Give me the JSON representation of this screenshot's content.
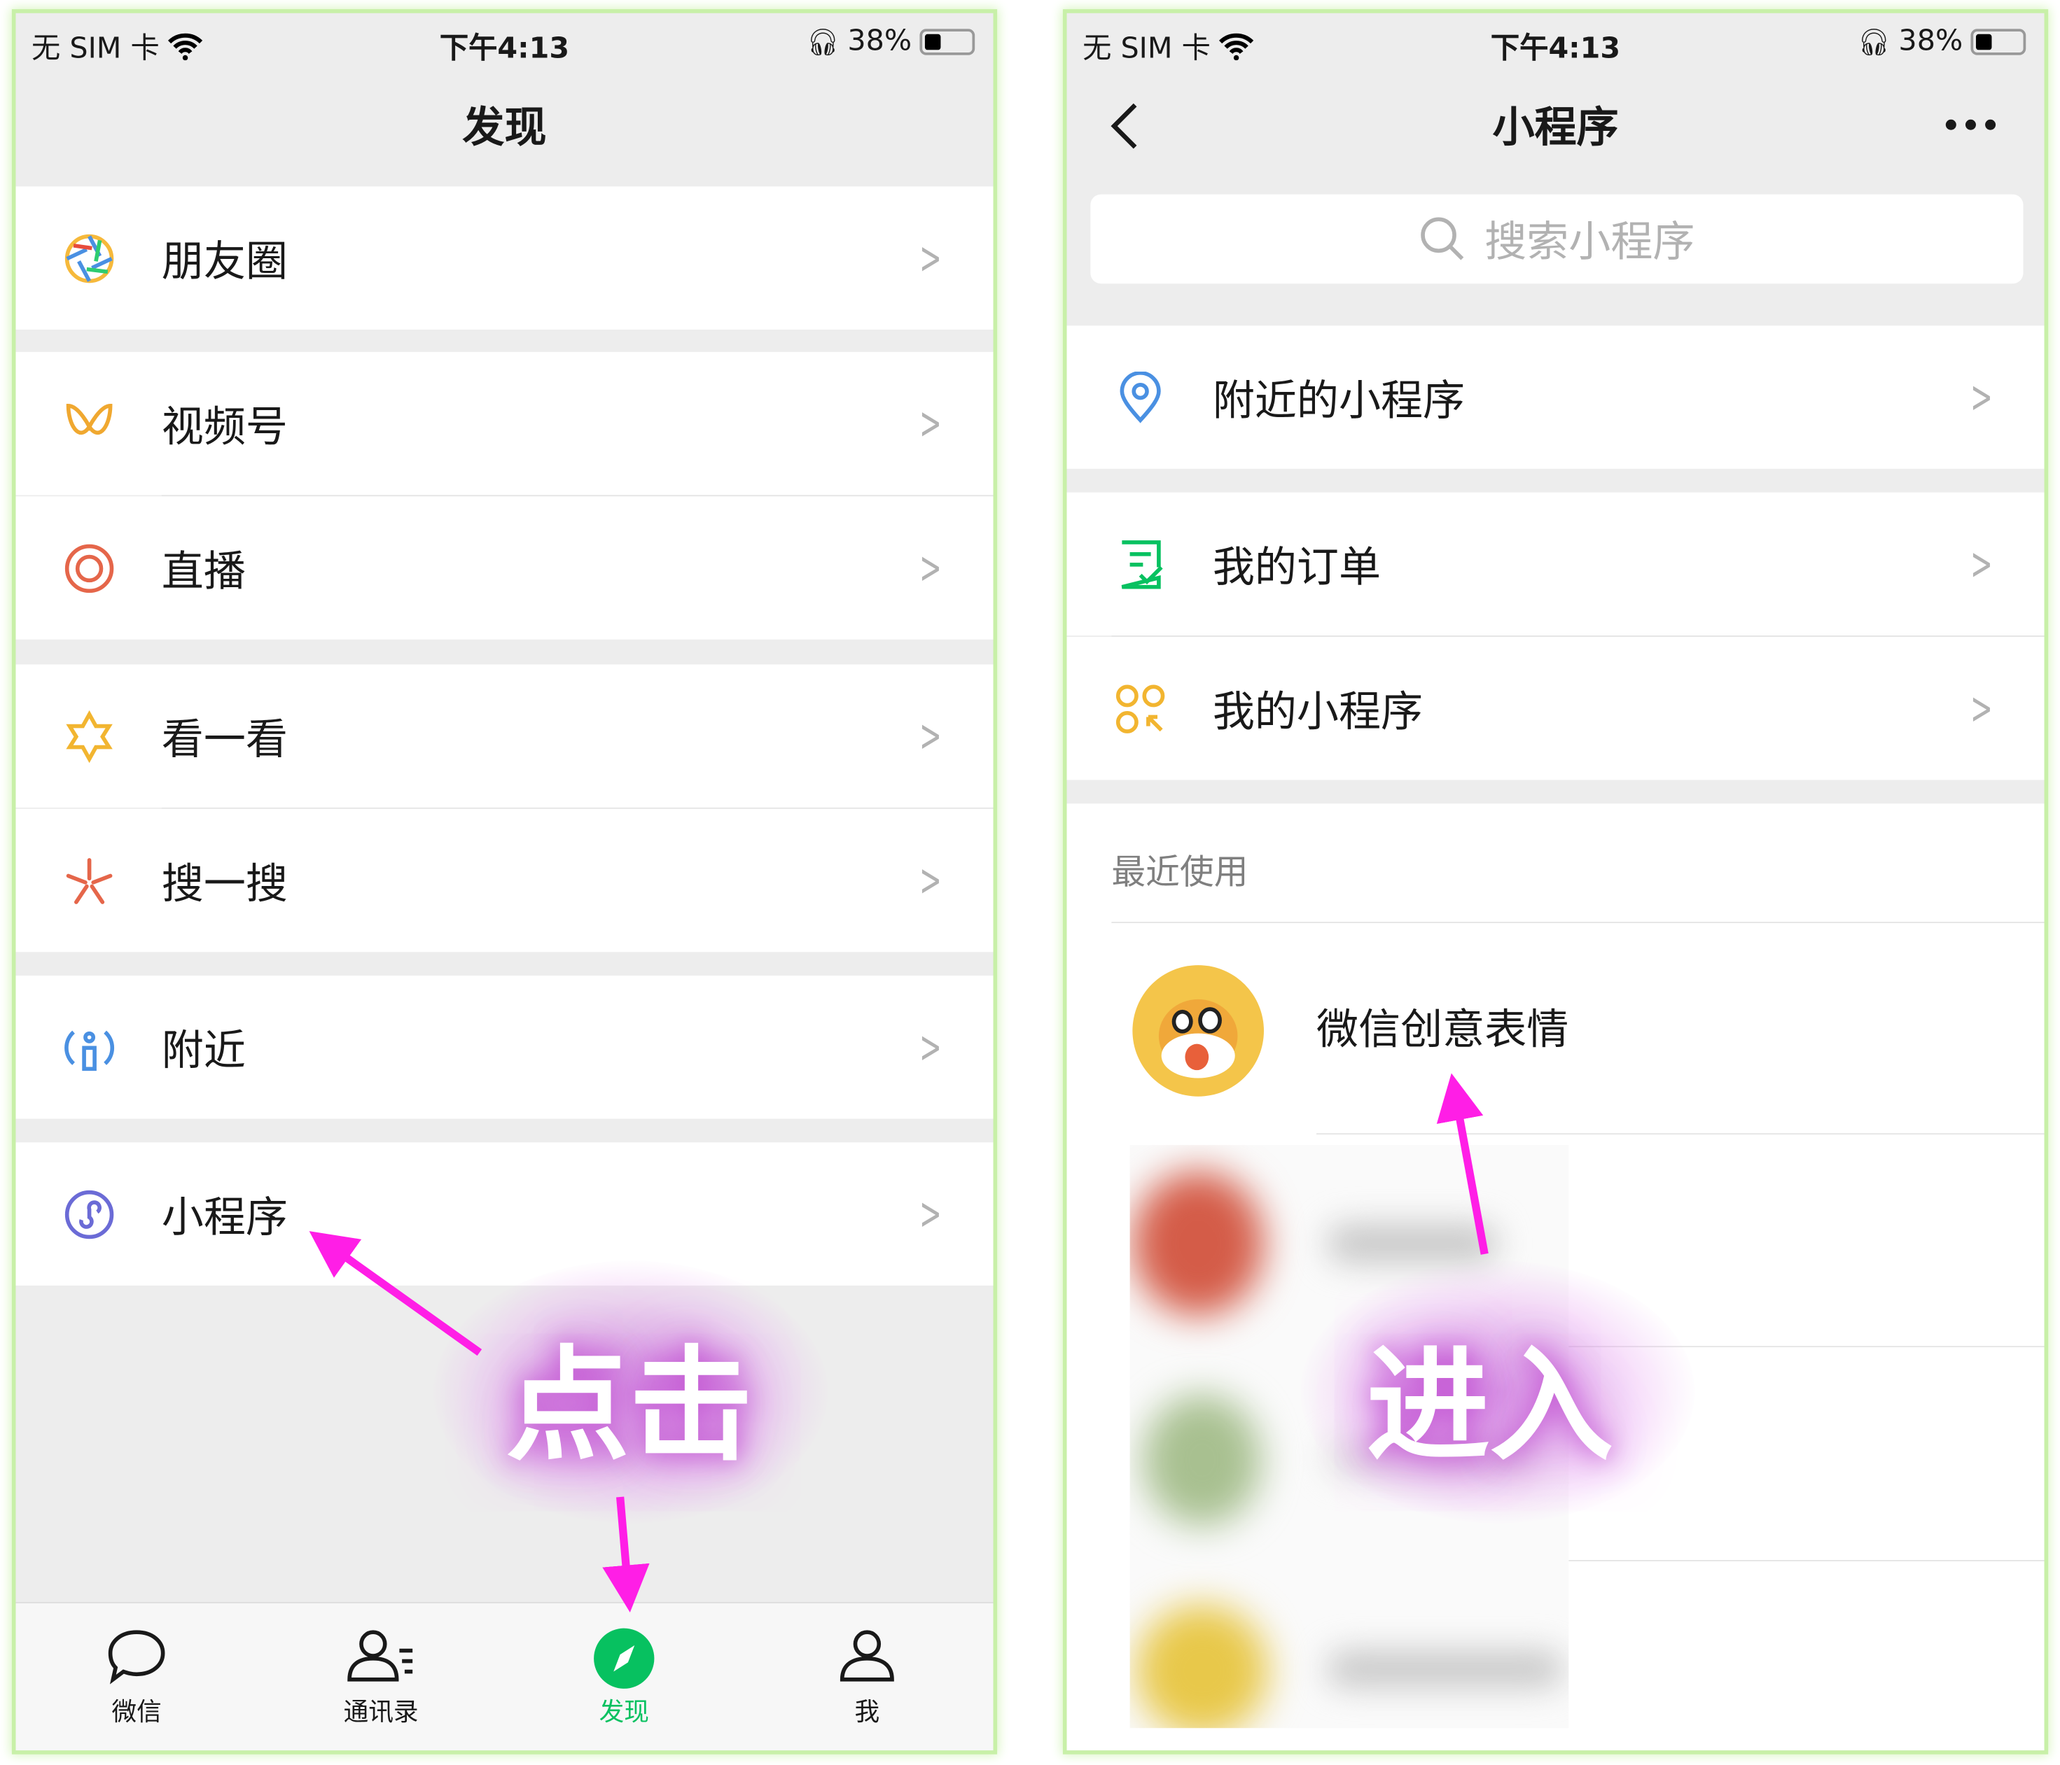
{
  "status_bar": {
    "carrier": "无 SIM 卡",
    "time": "下午4:13",
    "battery": "38%",
    "battery_level": 0.38
  },
  "left": {
    "title": "发现",
    "items": [
      {
        "label": "朋友圈",
        "icon": "moments-aperture-icon"
      },
      {
        "label": "视频号",
        "icon": "channels-icon"
      },
      {
        "label": "直播",
        "icon": "live-icon"
      },
      {
        "label": "看一看",
        "icon": "top-stories-icon"
      },
      {
        "label": "搜一搜",
        "icon": "search-sparkle-icon"
      },
      {
        "label": "附近",
        "icon": "nearby-icon"
      },
      {
        "label": "小程序",
        "icon": "mini-program-icon"
      }
    ],
    "tabs": [
      {
        "label": "微信",
        "icon": "chat-bubble-icon"
      },
      {
        "label": "通讯录",
        "icon": "contacts-icon"
      },
      {
        "label": "发现",
        "icon": "compass-icon",
        "active": true
      },
      {
        "label": "我",
        "icon": "person-icon"
      }
    ],
    "annotation": "点击"
  },
  "right": {
    "title": "小程序",
    "search_placeholder": "搜索小程序",
    "items": [
      {
        "label": "附近的小程序",
        "icon": "location-pin-icon"
      },
      {
        "label": "我的订单",
        "icon": "order-list-icon"
      },
      {
        "label": "我的小程序",
        "icon": "my-mini-programs-icon"
      }
    ],
    "recent_label": "最近使用",
    "recent": [
      {
        "label": "微信创意表情",
        "icon": "cat-emoji-avatar"
      }
    ],
    "annotation": "进入"
  },
  "colors": {
    "accent": "#07c160",
    "arrow": "#ff1ee6",
    "background": "#ededed"
  }
}
